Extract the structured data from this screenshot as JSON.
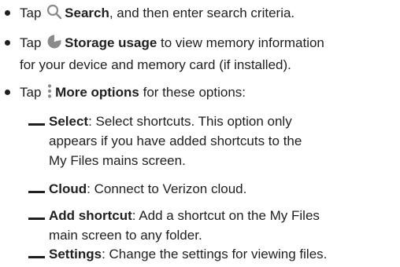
{
  "bullets": [
    {
      "prefix": "Tap",
      "icon": "search-icon",
      "label": "Search",
      "text": ", and then enter search criteria."
    },
    {
      "prefix": "Tap",
      "icon": "storage-pie-icon",
      "label": "Storage usage",
      "text_line1": " to view memory information",
      "text_line2": "for your device and memory card (if installed)."
    },
    {
      "prefix": "Tap",
      "icon": "more-options-icon",
      "label": "More options",
      "text": " for these options:"
    }
  ],
  "options": [
    {
      "label": "Select",
      "line1": ": Select shortcuts. This option only",
      "line2": "appears if you have added shortcuts to the",
      "line3": "My Files mains screen."
    },
    {
      "label": "Cloud",
      "line1": ": Connect to Verizon cloud."
    },
    {
      "label": "Add shortcut",
      "line1": ": Add a shortcut on the My Files",
      "line2": "main screen to any folder."
    },
    {
      "label": "Settings",
      "line1": ": Change the settings for viewing files."
    }
  ],
  "colors": {
    "text": "#1f1f1f",
    "icon": "#8a8a8a"
  }
}
